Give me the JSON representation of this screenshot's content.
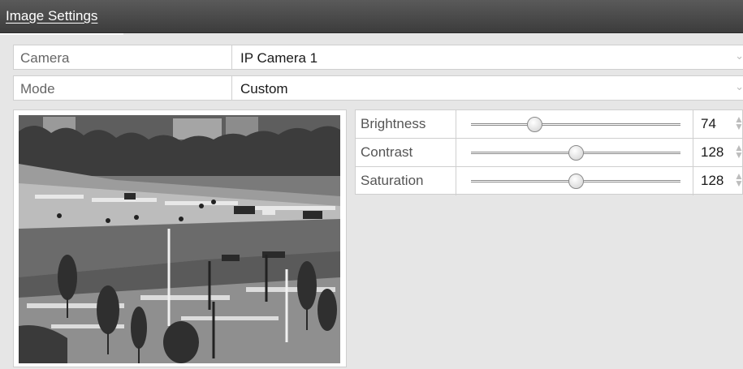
{
  "window": {
    "title": "Image Settings"
  },
  "camera": {
    "label": "Camera",
    "value": "IP Camera 1"
  },
  "mode": {
    "label": "Mode",
    "value": "Custom"
  },
  "adjustments": [
    {
      "label": "Brightness",
      "value": "74",
      "level": 74,
      "min": 0,
      "max": 255
    },
    {
      "label": "Contrast",
      "value": "128",
      "level": 128,
      "min": 0,
      "max": 255
    },
    {
      "label": "Saturation",
      "value": "128",
      "level": 128,
      "min": 0,
      "max": 255
    }
  ],
  "icons": {
    "dropdown": "chevron-down-icon",
    "spinner": "spinner-arrows-icon"
  }
}
